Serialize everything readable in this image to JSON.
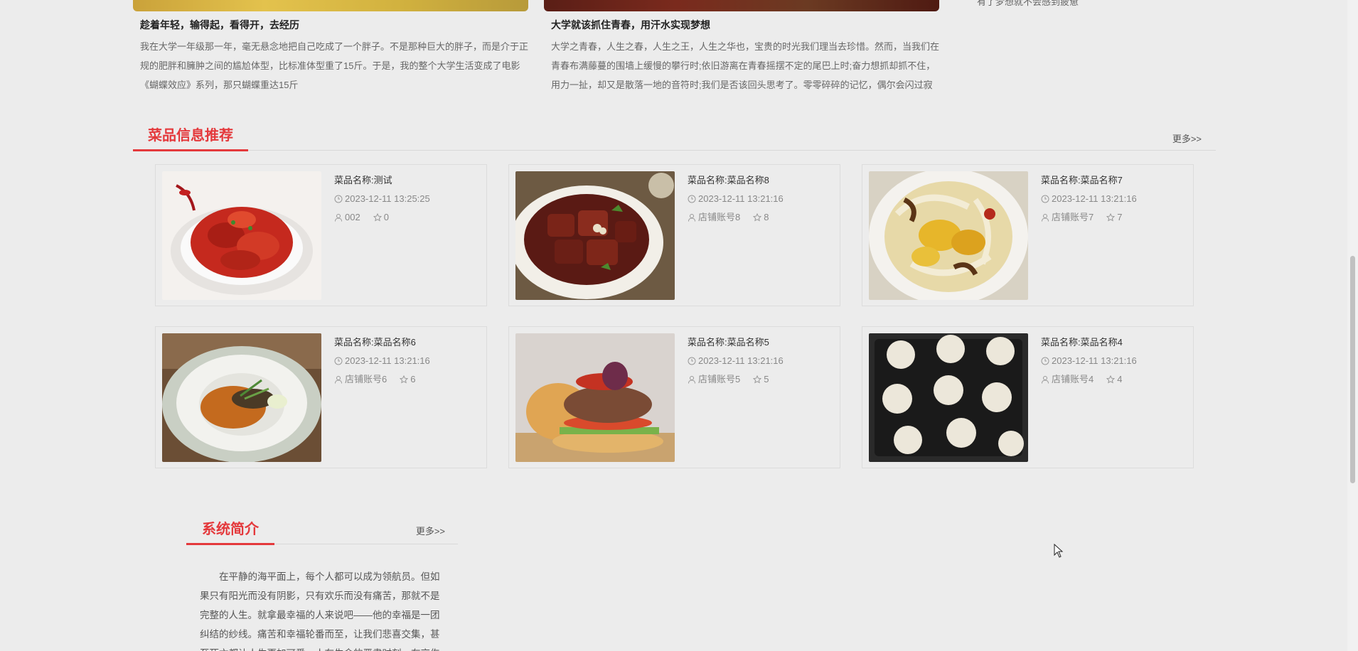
{
  "news": {
    "items": [
      {
        "title": "趁着年轻，输得起，看得开，去经历",
        "body": "我在大学一年级那一年，毫无悬念地把自己吃成了一个胖子。不是那种巨大的胖子，而是介于正规的肥胖和臃肿之间的尴尬体型，比标准体型重了15斤。于是，我的整个大学生活变成了电影《蝴蝶效应》系列，那只蝴蝶重达15斤"
      },
      {
        "title": "大学就该抓住青春，用汗水实现梦想",
        "body": "大学之青春，人生之春，人生之王，人生之华也，宝贵的时光我们理当去珍惜。然而，当我们在青春布满藤蔓的围墙上缓慢的攀行时;依旧游离在青春摇摆不定的尾巴上时;奋力想抓却抓不住，用力一扯，却又是散落一地的音符时;我们是否该回头思考了。零零碎碎的记忆，偶尔会闪过寂寞的"
      }
    ],
    "side_text": "有了梦想就不会感到疲惫"
  },
  "dishes_section": {
    "title": "菜品信息推荐",
    "more": "更多>>"
  },
  "dishes": [
    {
      "name": "菜品名称:测试",
      "time": "2023-12-11 13:25:25",
      "shop": "002",
      "stars": "0"
    },
    {
      "name": "菜品名称:菜品名称8",
      "time": "2023-12-11 13:21:16",
      "shop": "店铺账号8",
      "stars": "8"
    },
    {
      "name": "菜品名称:菜品名称7",
      "time": "2023-12-11 13:21:16",
      "shop": "店铺账号7",
      "stars": "7"
    },
    {
      "name": "菜品名称:菜品名称6",
      "time": "2023-12-11 13:21:16",
      "shop": "店铺账号6",
      "stars": "6"
    },
    {
      "name": "菜品名称:菜品名称5",
      "time": "2023-12-11 13:21:16",
      "shop": "店铺账号5",
      "stars": "5"
    },
    {
      "name": "菜品名称:菜品名称4",
      "time": "2023-12-11 13:21:16",
      "shop": "店铺账号4",
      "stars": "4"
    }
  ],
  "intro_section": {
    "title": "系统简介",
    "more": "更多>>",
    "body": "在平静的海平面上，每个人都可以成为领航员。但如果只有阳光而没有阴影，只有欢乐而没有痛苦，那就不是完整的人生。就拿最幸福的人来说吧——他的幸福是一团纠结的纱线。痛苦和幸福轮番而至，让我们悲喜交集，甚至死亡都让人生更加可爱。人在生命的严肃时刻，在哀伤与丧亲的阴影下，才是最接近真实的自我。"
  },
  "colors": {
    "accent": "#e4393c",
    "background": "#ececec"
  }
}
